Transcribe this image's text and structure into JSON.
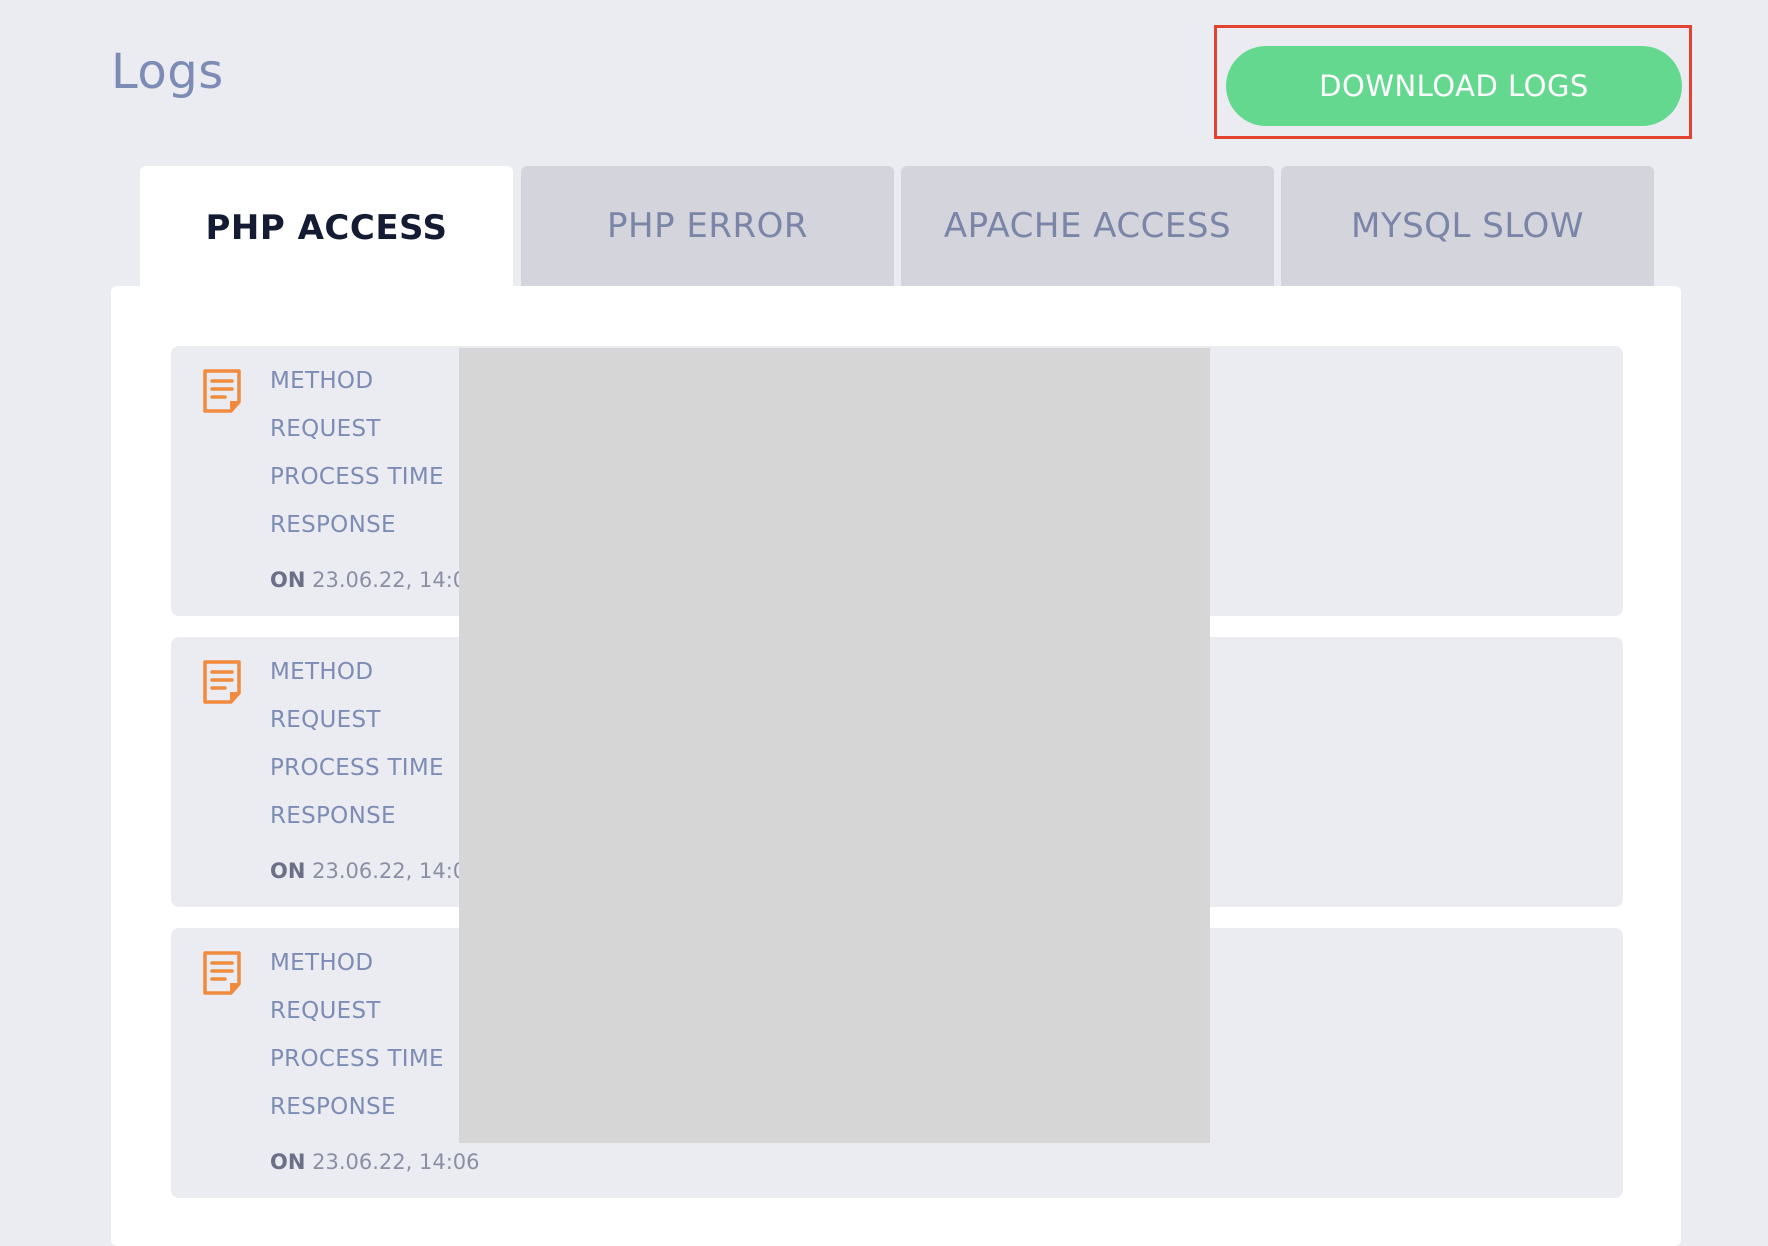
{
  "header": {
    "title": "Logs",
    "download_label": "DOWNLOAD LOGS"
  },
  "tabs": [
    {
      "label": "PHP ACCESS",
      "active": true
    },
    {
      "label": "PHP ERROR",
      "active": false
    },
    {
      "label": "APACHE ACCESS",
      "active": false
    },
    {
      "label": "MYSQL SLOW",
      "active": false
    }
  ],
  "log_fields": {
    "method": "METHOD",
    "request": "REQUEST",
    "process_time": "PROCESS TIME",
    "response": "RESPONSE",
    "on": "ON"
  },
  "logs": [
    {
      "timestamp": "23.06.22, 14:07"
    },
    {
      "timestamp": "23.06.22, 14:06"
    },
    {
      "timestamp": "23.06.22, 14:06"
    }
  ],
  "colors": {
    "background": "#ebecf1",
    "accent_green": "#65d88f",
    "highlight_red": "#e1432f",
    "icon_orange": "#f08a3c",
    "title_blue": "#7d8cb5"
  },
  "icons": {
    "log_entry": "document-icon"
  }
}
